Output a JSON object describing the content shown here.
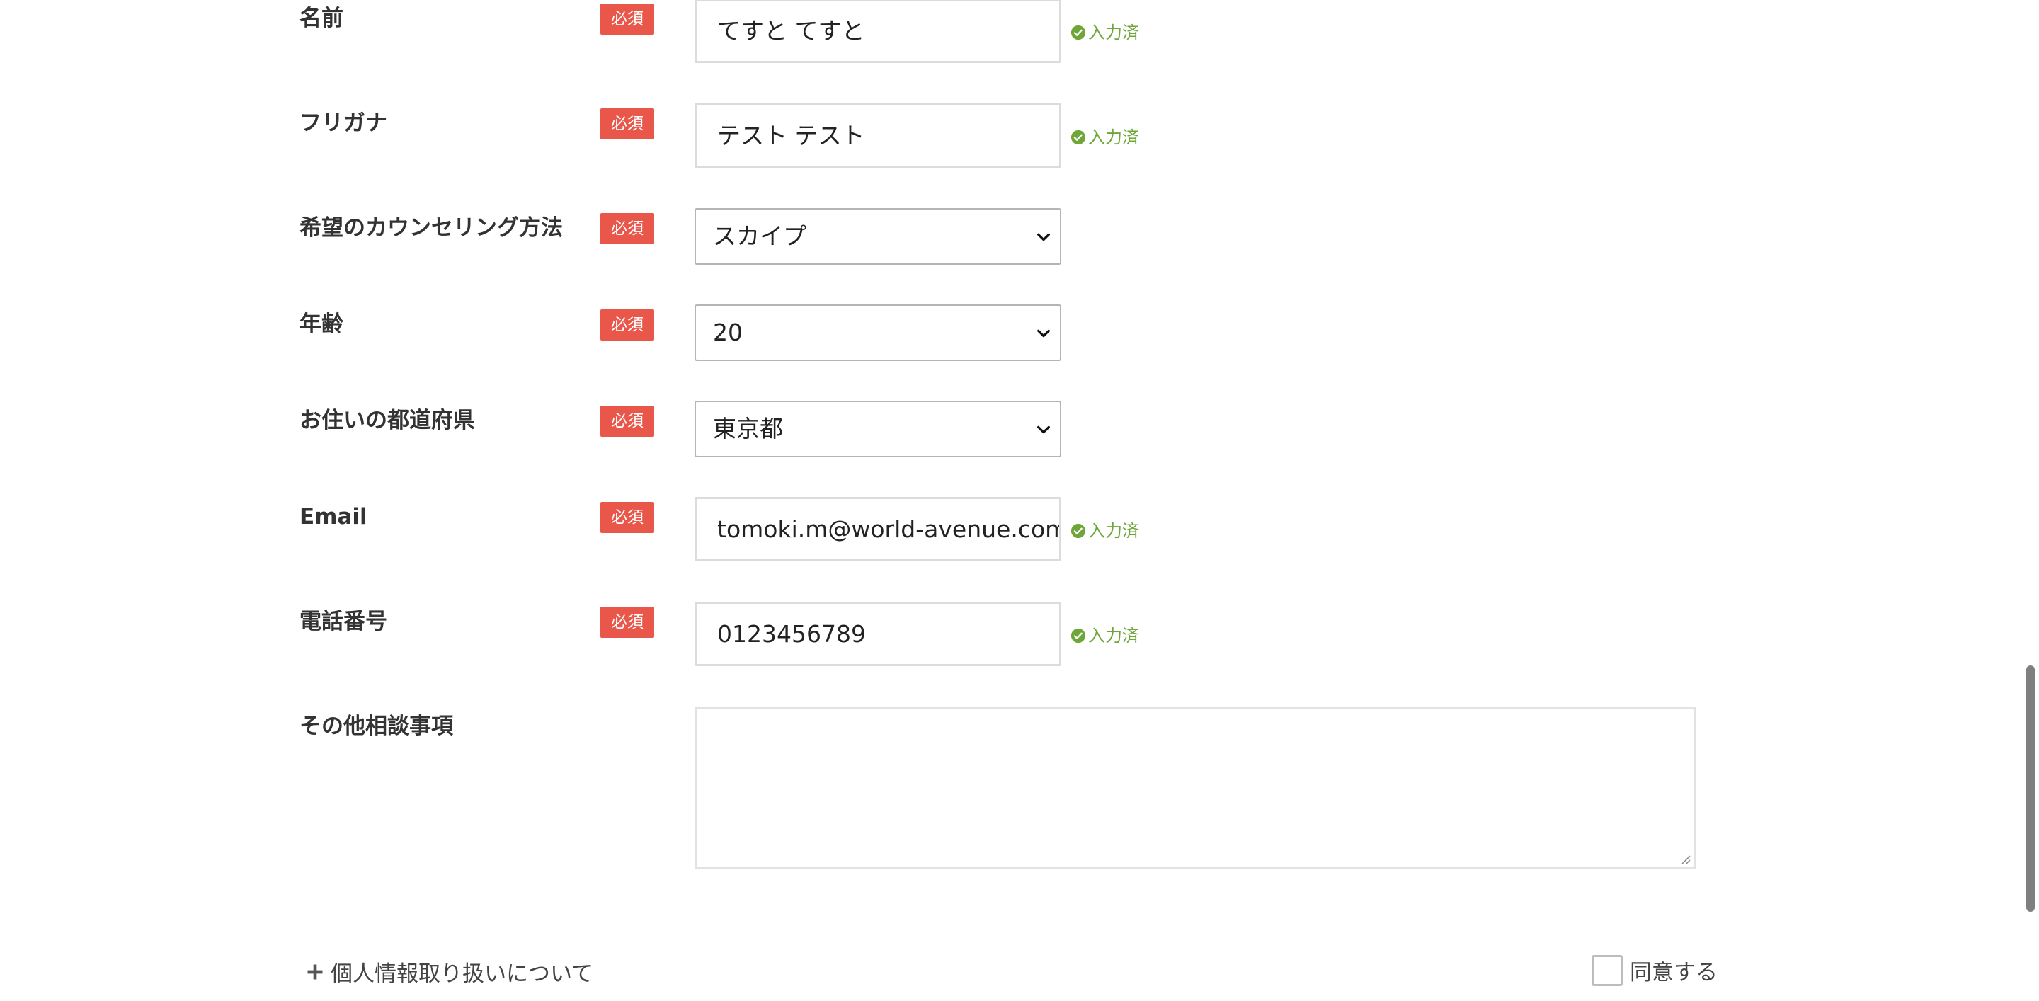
{
  "form": {
    "required_label": "必須",
    "filled_label": "入力済",
    "fields": {
      "name": {
        "label": "名前",
        "value": "てすと てすと"
      },
      "furigana": {
        "label": "フリガナ",
        "value": "テスト テスト"
      },
      "counseling_method": {
        "label": "希望のカウンセリング方法",
        "value": "スカイプ"
      },
      "age": {
        "label": "年齢",
        "value": "20"
      },
      "prefecture": {
        "label": "お住いの都道府県",
        "value": "東京都"
      },
      "email": {
        "label": "Email",
        "value": "tomoki.m@world-avenue.com"
      },
      "phone": {
        "label": "電話番号",
        "value": "0123456789"
      },
      "other": {
        "label": "その他相談事項",
        "value": ""
      }
    },
    "privacy_link": "個人情報取り扱いについて",
    "agree_label": "同意する"
  },
  "colors": {
    "required_bg": "#e9574a",
    "filled_text": "#6ea63a"
  },
  "icons": {
    "check": "check-circle-icon",
    "chevron": "chevron-down-icon",
    "plus": "plus-icon",
    "resize": "resize-handle-icon"
  }
}
